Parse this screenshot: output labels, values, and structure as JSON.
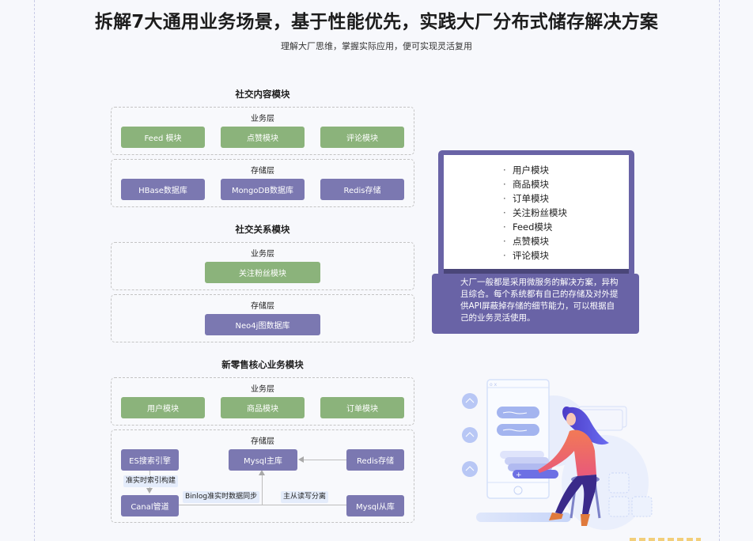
{
  "header": {
    "title": "拆解7大通用业务场景，基于性能优先，实践大厂分布式储存解决方案",
    "subtitle": "理解大厂思维，掌握实际应用，便可实现灵活复用"
  },
  "sections": [
    {
      "title": "社交内容模块",
      "business_layer": {
        "label": "业务层",
        "items": [
          "Feed 模块",
          "点赞模块",
          "评论模块"
        ]
      },
      "storage_layer": {
        "label": "存储层",
        "items": [
          "HBase数据库",
          "MongoDB数据库",
          "Redis存储"
        ]
      }
    },
    {
      "title": "社交关系模块",
      "business_layer": {
        "label": "业务层",
        "items": [
          "关注粉丝模块"
        ]
      },
      "storage_layer": {
        "label": "存储层",
        "items": [
          "Neo4j图数据库"
        ]
      }
    },
    {
      "title": "新零售核心业务模块",
      "business_layer": {
        "label": "业务层",
        "items": [
          "用户模块",
          "商品模块",
          "订单模块"
        ]
      },
      "storage_layer": {
        "label": "存储层",
        "nodes": {
          "es": "ES搜索引擎",
          "mysql_master": "Mysql主库",
          "redis": "Redis存储",
          "canal": "Canal管道",
          "mysql_slave": "Mysql从库"
        },
        "edge_labels": {
          "es_canal": "准实时索引构建",
          "canal_master": "Binlog准实时数据同步",
          "slave_master": "主从读写分离"
        }
      }
    }
  ],
  "laptop": {
    "modules": [
      "用户模块",
      "商品模块",
      "订单模块",
      "关注粉丝模块",
      "Feed模块",
      "点赞模块",
      "评论模块"
    ],
    "bullet": "·",
    "description": "大厂一般都是采用微服务的解决方案，异构且综合。每个系统都有自己的存储及对外提供API屏蔽掉存储的细节能力，可以根据自己的业务灵活使用。"
  },
  "colors": {
    "business": "#8bb37b",
    "storage": "#7b78b1",
    "laptop": "#6963a6",
    "tag_bg": "#e4ecfb"
  }
}
